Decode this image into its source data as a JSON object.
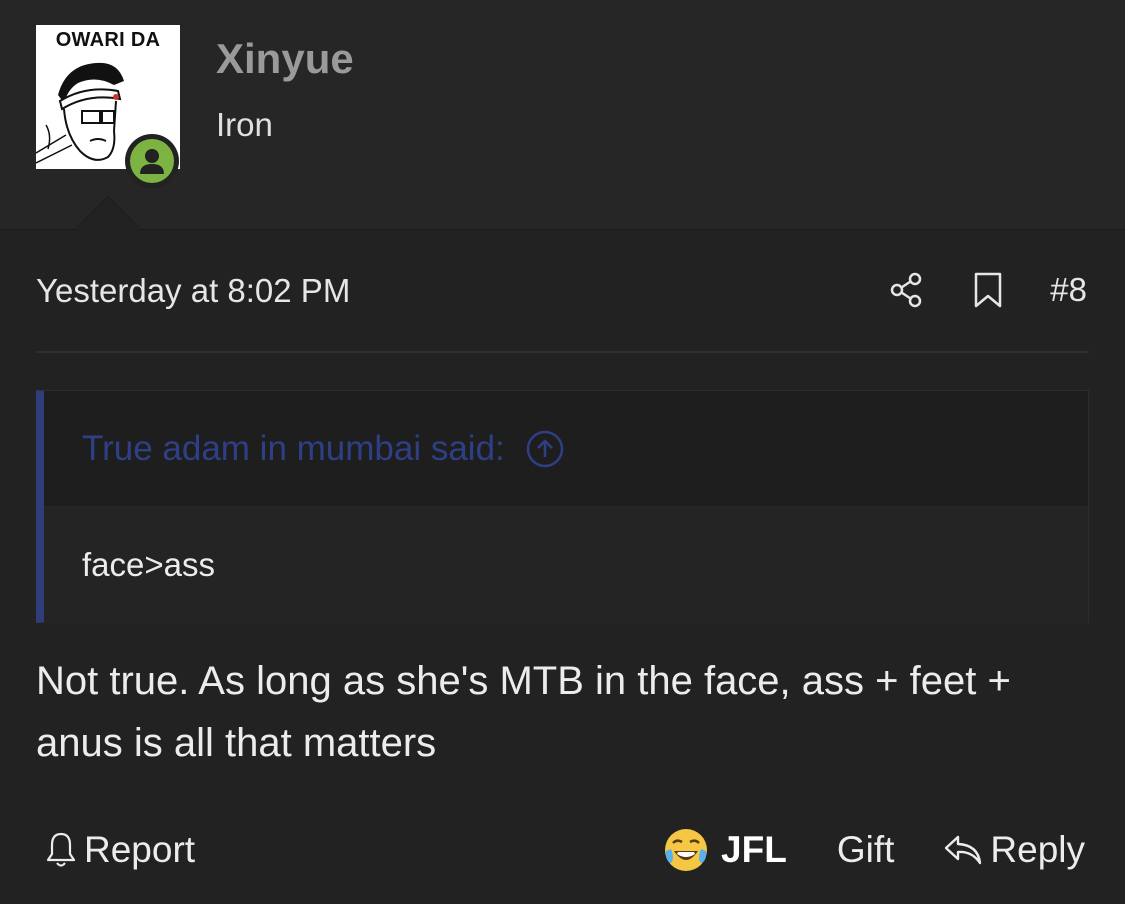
{
  "user": {
    "avatar_caption": "OWARI DA",
    "name": "Xinyue",
    "rank": "Iron",
    "online": true,
    "online_color": "#7cb342"
  },
  "post": {
    "date": "Yesterday at 8:02 PM",
    "number": "#8",
    "icons": [
      "share-icon",
      "bookmark-icon"
    ]
  },
  "quote": {
    "author_label": "True adam in mumbai said:",
    "text": "face>ass",
    "accent_color": "#2f3e7a"
  },
  "message": {
    "text": "Not true. As long as she's MTB in the face, ass + feet + anus is all that matters"
  },
  "footer": {
    "report_label": "Report",
    "reaction_label": "JFL",
    "reaction_icon": "crying-laughing-emoji",
    "gift_label": "Gift",
    "reply_label": "Reply"
  }
}
